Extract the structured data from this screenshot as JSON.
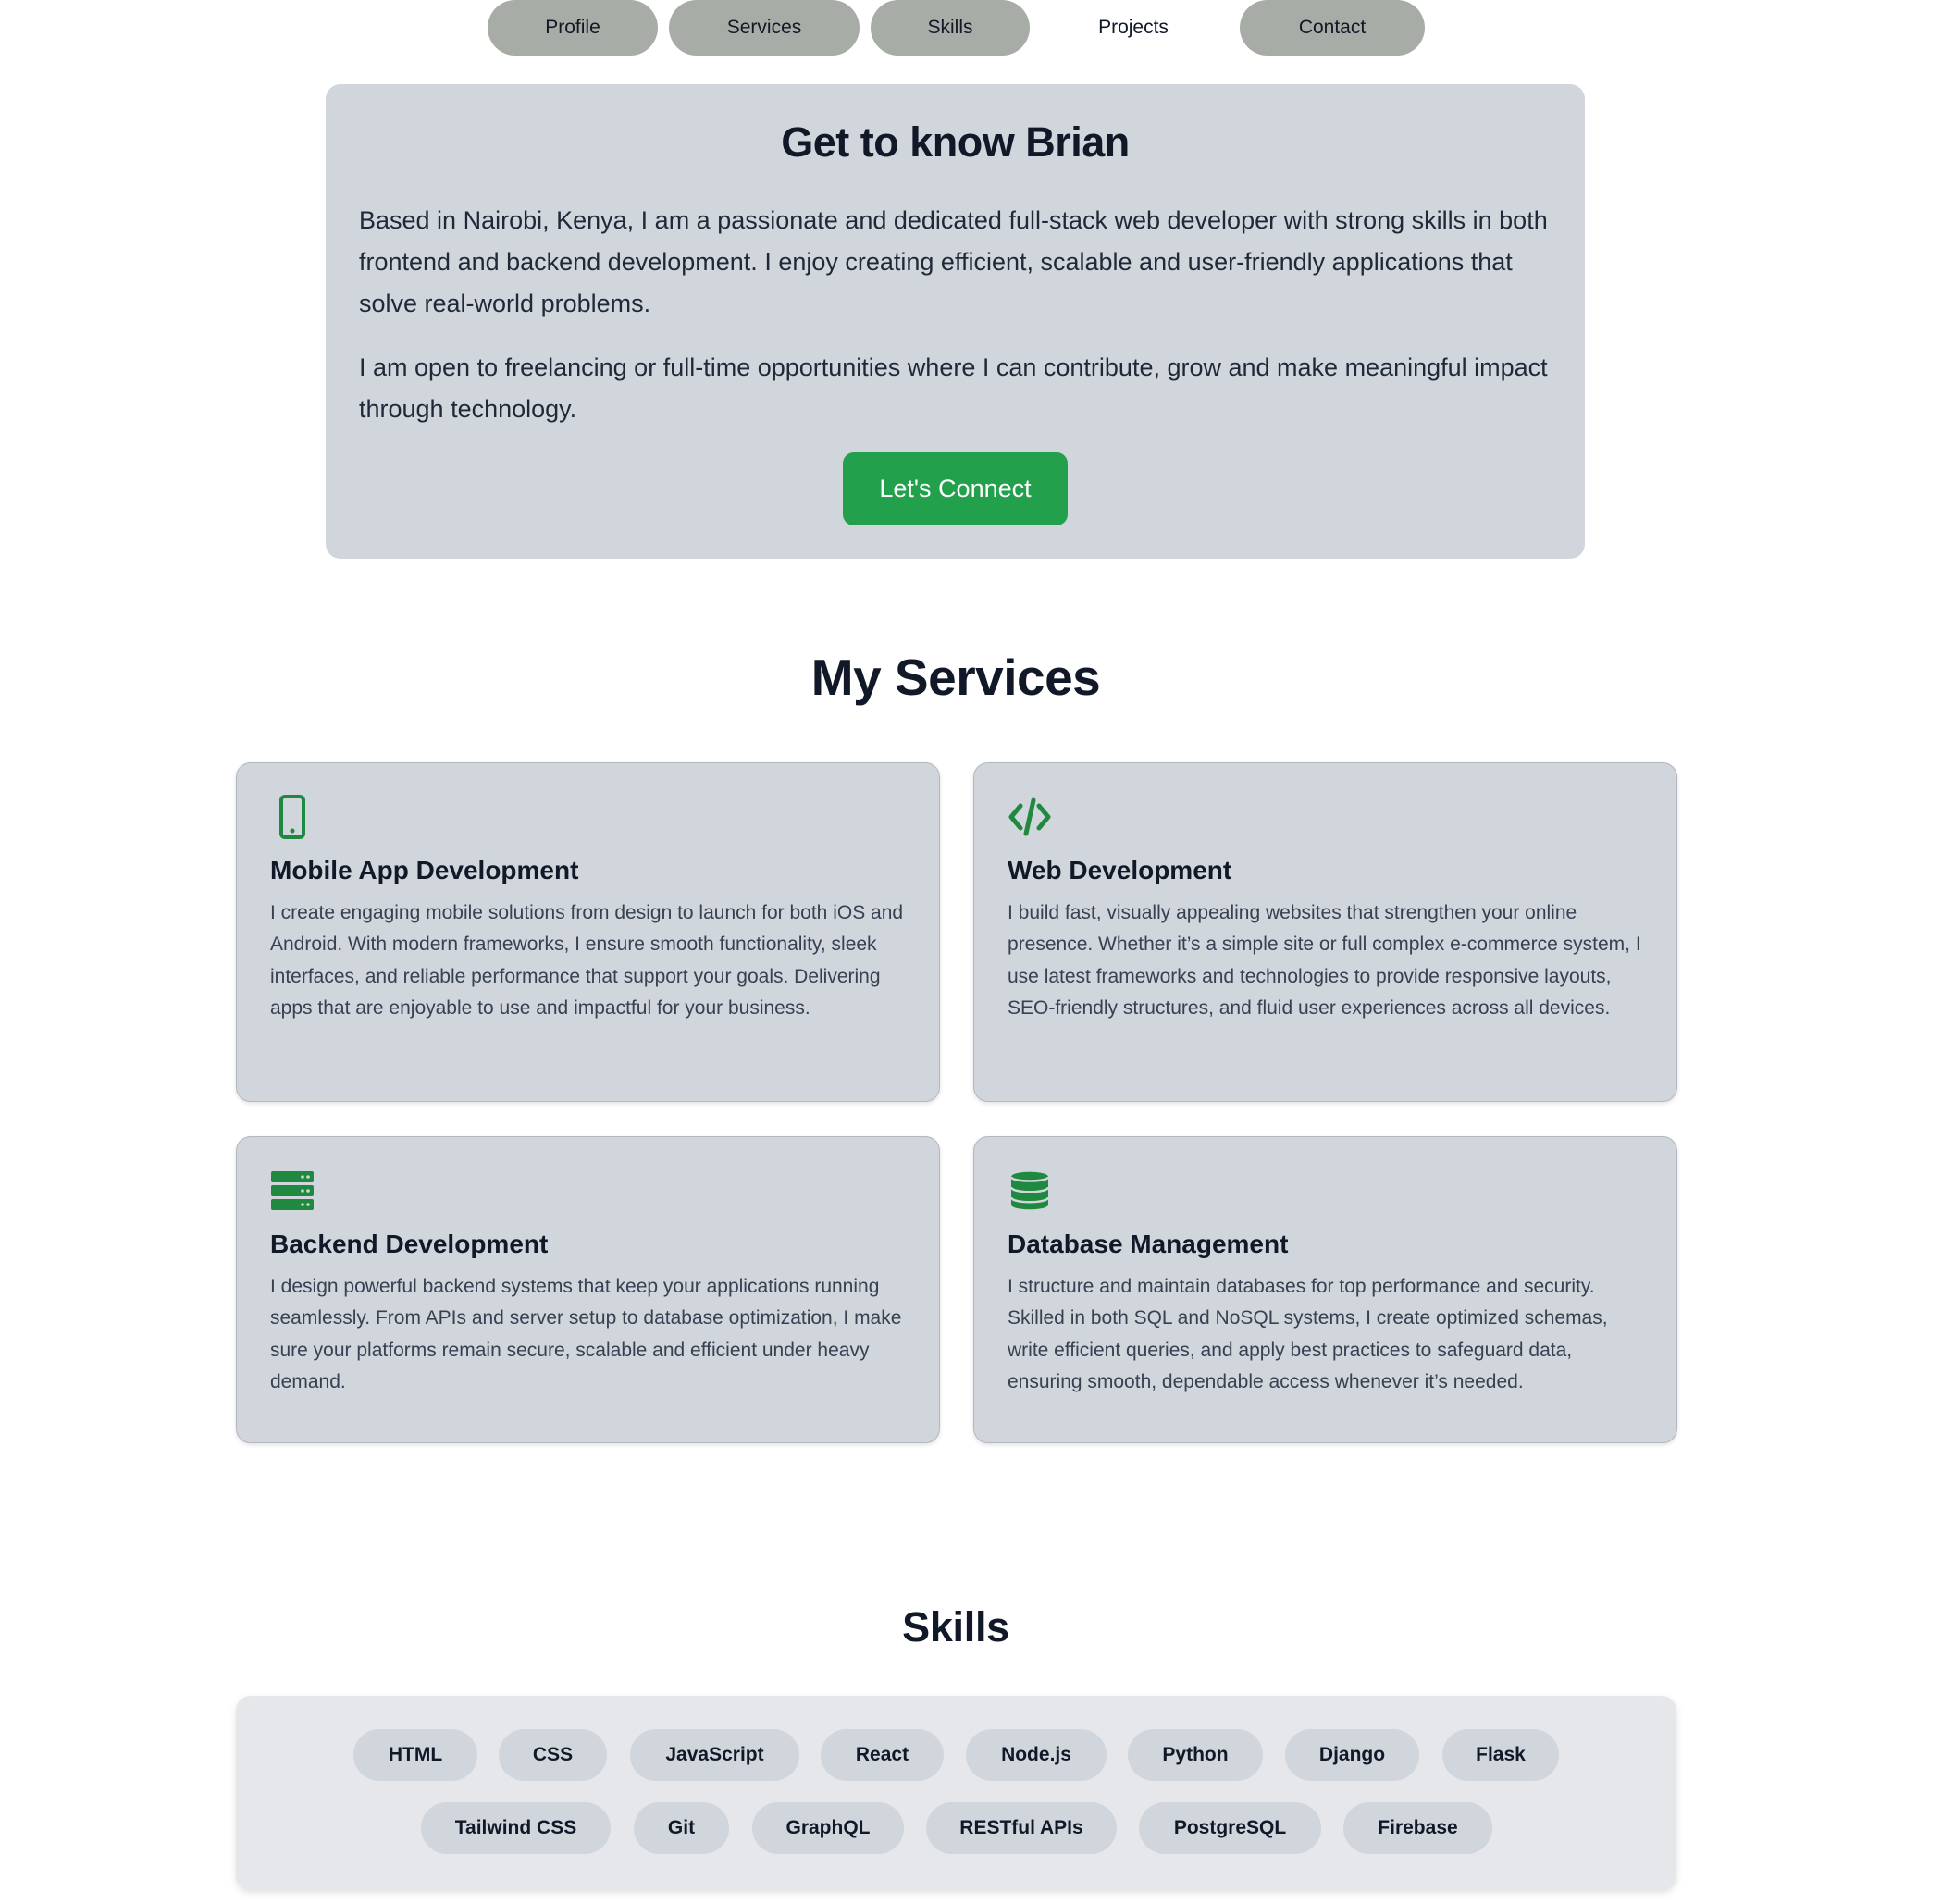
{
  "nav": {
    "items": [
      {
        "label": "Profile"
      },
      {
        "label": "Services"
      },
      {
        "label": "Skills"
      },
      {
        "label": "Projects"
      },
      {
        "label": "Contact"
      }
    ]
  },
  "about": {
    "title": "Get to know Brian",
    "paragraphs": [
      "Based in Nairobi, Kenya, I am a passionate and dedicated full-stack web developer with strong skills in both frontend and backend development. I enjoy creating efficient, scalable and user-friendly applications that solve real-world problems.",
      "I am open to freelancing or full-time opportunities where I can contribute, grow and make meaningful impact through technology."
    ],
    "cta_label": "Let's Connect"
  },
  "services": {
    "title": "My Services",
    "items": [
      {
        "icon": "mobile-phone-icon",
        "title": "Mobile App Development",
        "description": "I create engaging mobile solutions from design to launch for both iOS and Android. With modern frameworks, I ensure smooth functionality, sleek interfaces, and reliable performance that support your goals. Delivering apps that are enjoyable to use and impactful for your business."
      },
      {
        "icon": "code-icon",
        "title": "Web Development",
        "description": "I build fast, visually appealing websites that strengthen your online presence. Whether it’s a simple site or full complex e-commerce system, I use latest frameworks and technologies to provide responsive layouts, SEO-friendly structures, and fluid user experiences across all devices."
      },
      {
        "icon": "server-icon",
        "title": "Backend Development",
        "description": "I design powerful backend systems that keep your applications running seamlessly. From APIs and server setup to database optimization, I make sure your platforms remain secure, scalable and efficient under heavy demand."
      },
      {
        "icon": "database-icon",
        "title": "Database Management",
        "description": "I structure and maintain databases for top performance and security. Skilled in both SQL and NoSQL systems, I create optimized schemas, write efficient queries, and apply best practices to safeguard data, ensuring smooth, dependable access whenever it’s needed."
      }
    ]
  },
  "skills": {
    "title": "Skills",
    "items": [
      "HTML",
      "CSS",
      "JavaScript",
      "React",
      "Node.js",
      "Python",
      "Django",
      "Flask",
      "Tailwind CSS",
      "Git",
      "GraphQL",
      "RESTful APIs",
      "PostgreSQL",
      "Firebase"
    ]
  },
  "colors": {
    "accent": "#22a04b",
    "icon": "#1f8a3f",
    "card": "#d1d5dc",
    "nav_pill": "#a8aca6"
  }
}
